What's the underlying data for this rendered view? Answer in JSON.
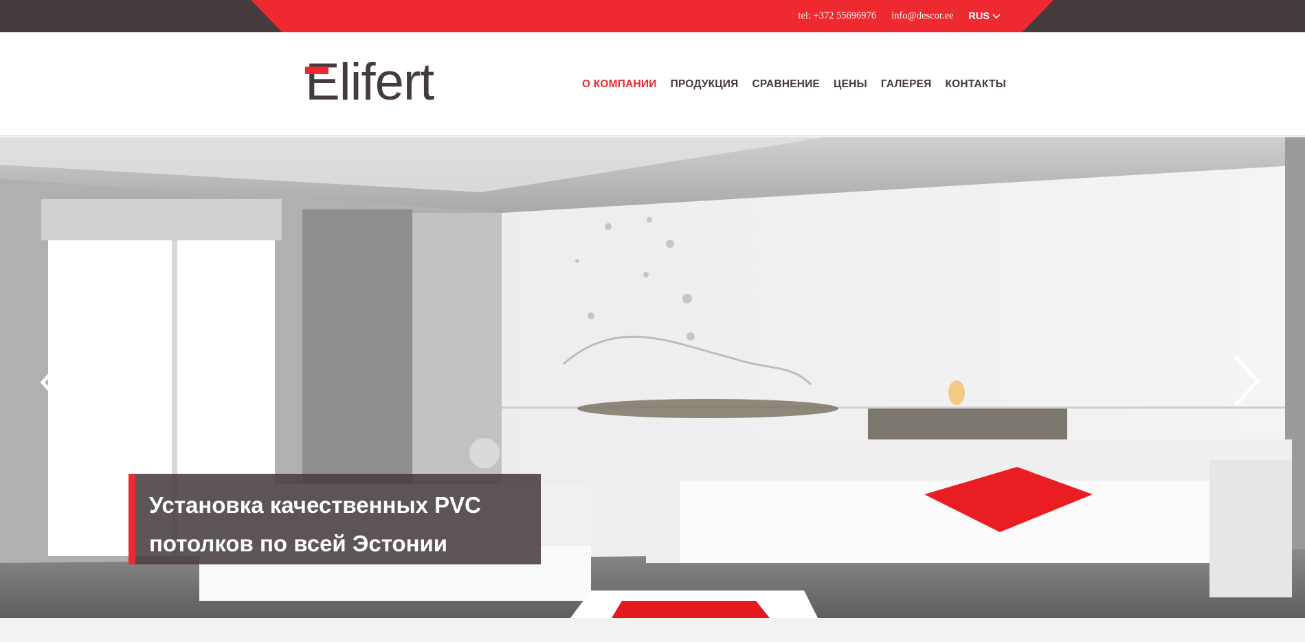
{
  "topbar": {
    "phone": "tel: +372 55696976",
    "email": "info@descor.ee",
    "language": "RUS",
    "language_icon": "chevron-down-icon",
    "colors": {
      "dark": "#453a3c",
      "accent": "#ee2a30"
    }
  },
  "header": {
    "logo": "Elifert",
    "nav": [
      {
        "label": "О КОМПАНИИ",
        "active": true
      },
      {
        "label": "ПРОДУКЦИЯ",
        "active": false
      },
      {
        "label": "СРАВНЕНИЕ",
        "active": false
      },
      {
        "label": "ЦЕНЫ",
        "active": false
      },
      {
        "label": "ГАЛЕРЕЯ",
        "active": false
      },
      {
        "label": "КОНТАКТЫ",
        "active": false
      }
    ]
  },
  "hero": {
    "caption_lines": [
      "Установка качественных PVC",
      "потолков по всей Эстонии"
    ],
    "prev_icon": "chevron-left-icon",
    "next_icon": "chevron-right-icon"
  }
}
